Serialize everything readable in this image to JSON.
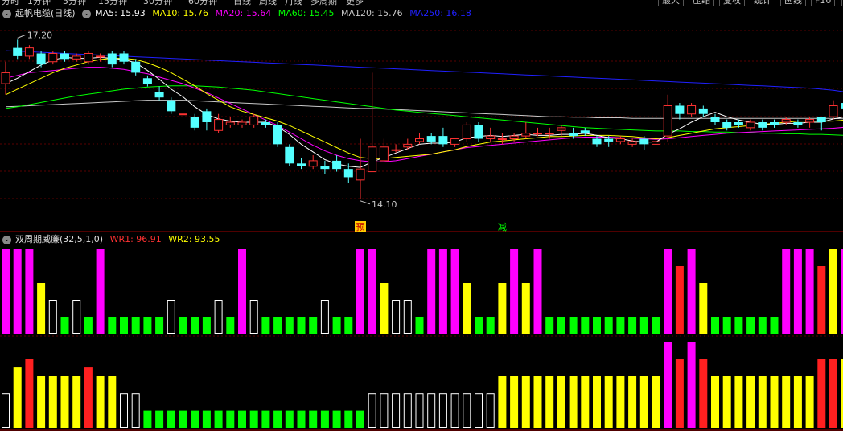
{
  "menu": {
    "items": [
      "分时",
      "1分钟",
      "5分钟",
      "15分钟",
      "30分钟",
      "60分钟",
      "日线",
      "周线",
      "月线",
      "多周期",
      "更多"
    ],
    "right_buttons": [
      "最大",
      "压缩",
      "复权",
      "统计",
      "画线",
      "F10",
      "标"
    ]
  },
  "colors": {
    "up": "#ff3232",
    "down": "#54ffff",
    "ma5": "#ffffff",
    "ma10": "#ffff00",
    "ma20": "#ff00ff",
    "ma60": "#00ff00",
    "ma120": "#c8c8c8",
    "ma250": "#2020ff",
    "wr_magenta": "#ff00ff",
    "wr_red": "#ff2020",
    "wr_yellow": "#ffff00",
    "wr_green": "#00ff00",
    "wr_white": "#ffffff"
  },
  "main_legend": {
    "title": "起帆电缆(日线)",
    "ma5": "MA5: 15.93",
    "ma10": "MA10: 15.76",
    "ma20": "MA20: 15.64",
    "ma60": "MA60: 15.45",
    "ma120": "MA120: 15.76",
    "ma250": "MA250: 16.18"
  },
  "indicator_legend": {
    "title": "双周期威廉(32,5,1,0)",
    "wr1": "WR1: 96.91",
    "wr2": "WR2: 93.55"
  },
  "annotations": {
    "high_label": "17.20",
    "low_label": "14.10",
    "marker_yu": "预",
    "marker_jian": "减"
  },
  "chart_data": [
    {
      "type": "candlestick",
      "title": "起帆电缆(日线)",
      "ylim": [
        13.8,
        17.6
      ],
      "open": [
        16.4,
        17.05,
        16.9,
        16.95,
        16.8,
        16.95,
        16.85,
        16.8,
        16.9,
        16.95,
        16.95,
        16.8,
        16.5,
        16.25,
        16.1,
        15.85,
        15.8,
        15.9,
        15.55,
        15.65,
        15.65,
        15.65,
        15.7,
        15.65,
        15.25,
        14.95,
        14.9,
        14.9,
        15.0,
        14.85,
        14.65,
        14.8,
        15.0,
        15.2,
        15.25,
        15.35,
        15.45,
        15.45,
        15.3,
        15.4,
        15.65,
        15.4,
        15.4,
        15.4,
        15.45,
        15.5,
        15.5,
        15.55,
        15.5,
        15.55,
        15.4,
        15.4,
        15.35,
        15.3,
        15.4,
        15.3,
        15.45,
        16.0,
        15.85,
        15.95,
        15.8,
        15.7,
        15.7,
        15.6,
        15.7,
        15.7,
        15.7,
        15.7,
        15.7,
        15.8,
        15.8,
        16.05,
        15.9,
        16.0
      ],
      "close": [
        16.6,
        16.9,
        17.05,
        16.75,
        16.95,
        16.85,
        16.9,
        16.95,
        16.9,
        16.75,
        16.8,
        16.6,
        16.4,
        16.15,
        15.9,
        15.85,
        15.6,
        15.7,
        15.75,
        15.7,
        15.7,
        15.8,
        15.65,
        15.3,
        14.95,
        14.9,
        15.0,
        14.85,
        14.85,
        14.7,
        14.85,
        15.25,
        15.25,
        15.2,
        15.3,
        15.4,
        15.35,
        15.3,
        15.4,
        15.65,
        15.4,
        15.45,
        15.4,
        15.45,
        15.5,
        15.5,
        15.5,
        15.6,
        15.45,
        15.5,
        15.3,
        15.35,
        15.4,
        15.35,
        15.3,
        15.35,
        16.0,
        15.85,
        16.0,
        15.85,
        15.7,
        15.6,
        15.65,
        15.7,
        15.6,
        15.65,
        15.75,
        15.65,
        15.75,
        15.7,
        16.0,
        15.95,
        16.05,
        16.05
      ],
      "high": [
        16.8,
        17.2,
        17.1,
        17.0,
        17.0,
        17.0,
        16.95,
        17.0,
        16.95,
        17.0,
        17.0,
        16.85,
        16.55,
        16.35,
        16.15,
        16.0,
        15.85,
        15.95,
        15.85,
        15.8,
        15.75,
        15.85,
        15.75,
        15.7,
        15.3,
        15.05,
        15.1,
        15.0,
        15.1,
        14.95,
        15.4,
        16.6,
        15.4,
        15.3,
        15.4,
        15.5,
        15.5,
        15.6,
        15.4,
        15.7,
        15.7,
        15.6,
        15.5,
        15.5,
        15.7,
        15.6,
        15.6,
        15.65,
        15.6,
        15.6,
        15.45,
        15.45,
        15.45,
        15.4,
        15.45,
        15.4,
        16.2,
        16.05,
        16.05,
        16.0,
        15.85,
        15.75,
        15.75,
        15.75,
        15.75,
        15.75,
        15.8,
        15.75,
        15.8,
        15.8,
        16.1,
        16.05,
        16.1,
        16.1
      ],
      "low": [
        16.2,
        16.85,
        16.85,
        16.7,
        16.75,
        16.8,
        16.8,
        16.75,
        16.8,
        16.7,
        16.75,
        16.55,
        16.35,
        16.1,
        15.85,
        15.65,
        15.55,
        15.55,
        15.5,
        15.6,
        15.6,
        15.6,
        15.6,
        15.25,
        14.9,
        14.85,
        14.85,
        14.75,
        14.8,
        14.6,
        14.3,
        15.05,
        15.15,
        15.15,
        15.2,
        15.3,
        15.3,
        15.25,
        15.25,
        15.35,
        15.35,
        15.35,
        15.3,
        15.35,
        15.4,
        15.45,
        15.4,
        15.45,
        15.4,
        15.45,
        15.25,
        15.25,
        15.3,
        15.25,
        15.2,
        15.25,
        15.35,
        15.75,
        15.8,
        15.8,
        15.65,
        15.55,
        15.6,
        15.55,
        15.55,
        15.6,
        15.65,
        15.6,
        15.6,
        15.55,
        15.75,
        15.8,
        15.85,
        15.85
      ],
      "ma5": [
        16.4,
        16.5,
        16.62,
        16.74,
        16.83,
        16.88,
        16.86,
        16.86,
        16.88,
        16.86,
        16.84,
        16.78,
        16.64,
        16.48,
        16.3,
        16.16,
        15.98,
        15.84,
        15.76,
        15.72,
        15.7,
        15.7,
        15.7,
        15.62,
        15.48,
        15.3,
        15.16,
        15.02,
        14.94,
        14.9,
        14.88,
        14.98,
        15.06,
        15.14,
        15.22,
        15.3,
        15.32,
        15.32,
        15.34,
        15.42,
        15.44,
        15.46,
        15.44,
        15.46,
        15.48,
        15.46,
        15.46,
        15.48,
        15.48,
        15.5,
        15.46,
        15.42,
        15.4,
        15.36,
        15.34,
        15.34,
        15.48,
        15.58,
        15.7,
        15.8,
        15.88,
        15.8,
        15.74,
        15.7,
        15.66,
        15.66,
        15.68,
        15.68,
        15.7,
        15.7,
        15.76,
        15.8,
        15.86,
        15.93
      ],
      "ma10": [
        16.2,
        16.3,
        16.4,
        16.5,
        16.6,
        16.68,
        16.74,
        16.8,
        16.84,
        16.86,
        16.86,
        16.84,
        16.78,
        16.7,
        16.6,
        16.48,
        16.36,
        16.22,
        16.1,
        15.98,
        15.9,
        15.84,
        15.78,
        15.72,
        15.64,
        15.54,
        15.44,
        15.34,
        15.24,
        15.14,
        15.06,
        15.04,
        15.04,
        15.06,
        15.08,
        15.1,
        15.12,
        15.16,
        15.2,
        15.26,
        15.3,
        15.34,
        15.36,
        15.38,
        15.4,
        15.42,
        15.44,
        15.44,
        15.45,
        15.46,
        15.46,
        15.46,
        15.45,
        15.44,
        15.42,
        15.4,
        15.42,
        15.46,
        15.5,
        15.54,
        15.58,
        15.6,
        15.62,
        15.64,
        15.66,
        15.68,
        15.7,
        15.72,
        15.72,
        15.72,
        15.72,
        15.74,
        15.75,
        15.76
      ],
      "ma20": [
        16.5,
        16.55,
        16.6,
        16.62,
        16.64,
        16.66,
        16.68,
        16.7,
        16.7,
        16.68,
        16.66,
        16.62,
        16.58,
        16.52,
        16.46,
        16.4,
        16.32,
        16.24,
        16.14,
        16.04,
        15.94,
        15.84,
        15.74,
        15.64,
        15.52,
        15.4,
        15.28,
        15.18,
        15.1,
        15.04,
        15.0,
        14.98,
        14.98,
        15.0,
        15.04,
        15.08,
        15.12,
        15.16,
        15.2,
        15.24,
        15.26,
        15.28,
        15.3,
        15.32,
        15.34,
        15.36,
        15.38,
        15.4,
        15.42,
        15.43,
        15.43,
        15.43,
        15.42,
        15.41,
        15.4,
        15.39,
        15.4,
        15.42,
        15.44,
        15.46,
        15.48,
        15.5,
        15.51,
        15.52,
        15.53,
        15.54,
        15.55,
        15.56,
        15.57,
        15.58,
        15.59,
        15.61,
        15.63,
        15.64
      ],
      "ma60": [
        15.95,
        15.98,
        16.02,
        16.06,
        16.1,
        16.14,
        16.18,
        16.21,
        16.24,
        16.27,
        16.3,
        16.32,
        16.34,
        16.35,
        16.36,
        16.36,
        16.36,
        16.35,
        16.34,
        16.32,
        16.3,
        16.28,
        16.25,
        16.22,
        16.19,
        16.16,
        16.13,
        16.1,
        16.07,
        16.04,
        16.01,
        15.98,
        15.95,
        15.92,
        15.9,
        15.88,
        15.86,
        15.84,
        15.82,
        15.8,
        15.78,
        15.76,
        15.74,
        15.72,
        15.7,
        15.68,
        15.66,
        15.64,
        15.62,
        15.6,
        15.59,
        15.58,
        15.57,
        15.56,
        15.55,
        15.54,
        15.54,
        15.54,
        15.53,
        15.53,
        15.52,
        15.52,
        15.51,
        15.51,
        15.5,
        15.5,
        15.49,
        15.49,
        15.48,
        15.48,
        15.47,
        15.46,
        15.46,
        15.45
      ],
      "ma120": [
        15.98,
        15.99,
        16.0,
        16.01,
        16.02,
        16.03,
        16.04,
        16.05,
        16.06,
        16.07,
        16.08,
        16.09,
        16.1,
        16.1,
        16.1,
        16.1,
        16.09,
        16.08,
        16.07,
        16.06,
        16.05,
        16.04,
        16.03,
        16.02,
        16.01,
        16.0,
        15.99,
        15.98,
        15.97,
        15.96,
        15.95,
        15.95,
        15.94,
        15.93,
        15.92,
        15.91,
        15.9,
        15.89,
        15.88,
        15.87,
        15.86,
        15.85,
        15.84,
        15.83,
        15.82,
        15.81,
        15.8,
        15.8,
        15.79,
        15.79,
        15.78,
        15.78,
        15.78,
        15.77,
        15.77,
        15.77,
        15.77,
        15.77,
        15.77,
        15.77,
        15.77,
        15.77,
        15.77,
        15.77,
        15.77,
        15.77,
        15.77,
        15.77,
        15.77,
        15.77,
        15.77,
        15.76,
        15.76,
        15.76
      ],
      "ma250": [
        17.0,
        16.99,
        16.98,
        16.97,
        16.96,
        16.95,
        16.94,
        16.93,
        16.92,
        16.91,
        16.9,
        16.89,
        16.88,
        16.87,
        16.86,
        16.85,
        16.84,
        16.83,
        16.82,
        16.81,
        16.8,
        16.79,
        16.78,
        16.77,
        16.76,
        16.75,
        16.74,
        16.73,
        16.72,
        16.71,
        16.7,
        16.69,
        16.68,
        16.67,
        16.66,
        16.65,
        16.64,
        16.63,
        16.62,
        16.61,
        16.6,
        16.59,
        16.58,
        16.57,
        16.56,
        16.55,
        16.54,
        16.53,
        16.52,
        16.51,
        16.5,
        16.49,
        16.48,
        16.47,
        16.46,
        16.45,
        16.44,
        16.43,
        16.42,
        16.41,
        16.4,
        16.39,
        16.38,
        16.37,
        16.36,
        16.35,
        16.34,
        16.33,
        16.32,
        16.3,
        16.28,
        16.25,
        16.22,
        16.18
      ],
      "high_marker": "17.20",
      "low_marker": "14.10"
    },
    {
      "type": "bar",
      "title": "双周期威廉(32,5,1,0)",
      "series_name": "WR1",
      "ylim": [
        0,
        100
      ],
      "values": [
        100,
        100,
        100,
        60,
        40,
        20,
        40,
        20,
        100,
        20,
        20,
        20,
        20,
        20,
        40,
        20,
        20,
        20,
        40,
        20,
        100,
        40,
        20,
        20,
        20,
        20,
        20,
        40,
        20,
        20,
        100,
        100,
        60,
        40,
        40,
        20,
        100,
        100,
        100,
        60,
        20,
        20,
        60,
        100,
        60,
        100,
        20,
        20,
        20,
        20,
        20,
        20,
        20,
        20,
        20,
        20,
        100,
        80,
        100,
        60,
        20,
        20,
        20,
        20,
        20,
        20,
        100,
        100,
        100,
        80,
        100,
        100,
        60,
        80
      ],
      "color_keys": [
        "m",
        "m",
        "m",
        "y",
        "w",
        "g",
        "w",
        "g",
        "m",
        "g",
        "g",
        "g",
        "g",
        "g",
        "w",
        "g",
        "g",
        "g",
        "w",
        "g",
        "m",
        "w",
        "g",
        "g",
        "g",
        "g",
        "g",
        "w",
        "g",
        "g",
        "m",
        "m",
        "y",
        "w",
        "w",
        "g",
        "m",
        "m",
        "m",
        "y",
        "g",
        "g",
        "y",
        "m",
        "y",
        "m",
        "g",
        "g",
        "g",
        "g",
        "g",
        "g",
        "g",
        "g",
        "g",
        "g",
        "m",
        "r",
        "m",
        "y",
        "g",
        "g",
        "g",
        "g",
        "g",
        "g",
        "m",
        "m",
        "m",
        "r",
        "y",
        "m",
        "y",
        "r"
      ]
    },
    {
      "type": "bar",
      "title": "双周期威廉(32,5,1,0)",
      "series_name": "WR2",
      "ylim": [
        0,
        100
      ],
      "values": [
        40,
        70,
        80,
        60,
        60,
        60,
        60,
        70,
        60,
        60,
        40,
        40,
        20,
        20,
        20,
        20,
        20,
        20,
        20,
        20,
        20,
        20,
        20,
        20,
        20,
        20,
        20,
        20,
        20,
        20,
        20,
        40,
        40,
        40,
        40,
        40,
        40,
        40,
        40,
        40,
        40,
        40,
        60,
        60,
        60,
        60,
        60,
        60,
        60,
        60,
        60,
        60,
        60,
        60,
        60,
        60,
        100,
        80,
        100,
        80,
        60,
        60,
        60,
        60,
        60,
        60,
        60,
        60,
        60,
        80,
        80,
        80,
        100,
        80
      ],
      "color_keys": [
        "w",
        "y",
        "r",
        "y",
        "y",
        "y",
        "y",
        "r",
        "y",
        "y",
        "w",
        "w",
        "g",
        "g",
        "g",
        "g",
        "g",
        "g",
        "g",
        "g",
        "g",
        "g",
        "g",
        "g",
        "g",
        "g",
        "g",
        "g",
        "g",
        "g",
        "g",
        "w",
        "w",
        "w",
        "w",
        "w",
        "w",
        "w",
        "w",
        "w",
        "w",
        "w",
        "y",
        "y",
        "y",
        "y",
        "y",
        "y",
        "y",
        "y",
        "y",
        "y",
        "y",
        "y",
        "y",
        "y",
        "m",
        "r",
        "m",
        "r",
        "y",
        "y",
        "y",
        "y",
        "y",
        "y",
        "y",
        "y",
        "y",
        "r",
        "r",
        "y",
        "m",
        "r"
      ]
    }
  ]
}
